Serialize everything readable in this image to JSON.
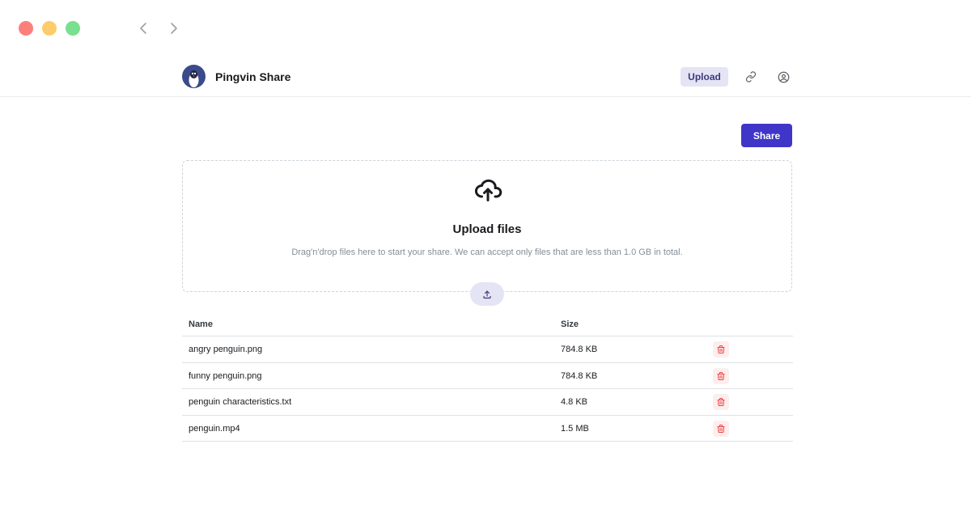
{
  "window": {
    "controls": [
      "close",
      "minimize",
      "maximize"
    ],
    "nav": {
      "back_icon": "chevron-left-icon",
      "forward_icon": "chevron-right-icon"
    }
  },
  "header": {
    "app_title": "Pingvin Share",
    "logo_icon": "penguin-logo-icon",
    "upload_label": "Upload",
    "link_icon": "link-icon",
    "user_icon": "user-circle-icon"
  },
  "main": {
    "share_label": "Share",
    "dropzone": {
      "icon": "cloud-upload-icon",
      "title": "Upload files",
      "subtitle": "Drag'n'drop files here to start your share. We can accept only files that are less than 1.0 GB in total.",
      "button_icon": "upload-icon"
    },
    "table": {
      "columns": [
        "Name",
        "Size"
      ],
      "rows": [
        {
          "name": "angry penguin.png",
          "size": "784.8 KB"
        },
        {
          "name": "funny penguin.png",
          "size": "784.8 KB"
        },
        {
          "name": "penguin characteristics.txt",
          "size": "4.8 KB"
        },
        {
          "name": "penguin.mp4",
          "size": "1.5 MB"
        }
      ],
      "delete_icon": "trash-icon"
    }
  },
  "colors": {
    "accent": "#3f35c8",
    "accent_light": "#e5e4f5",
    "danger": "#f03e3e",
    "danger_light": "#fdeeee"
  }
}
